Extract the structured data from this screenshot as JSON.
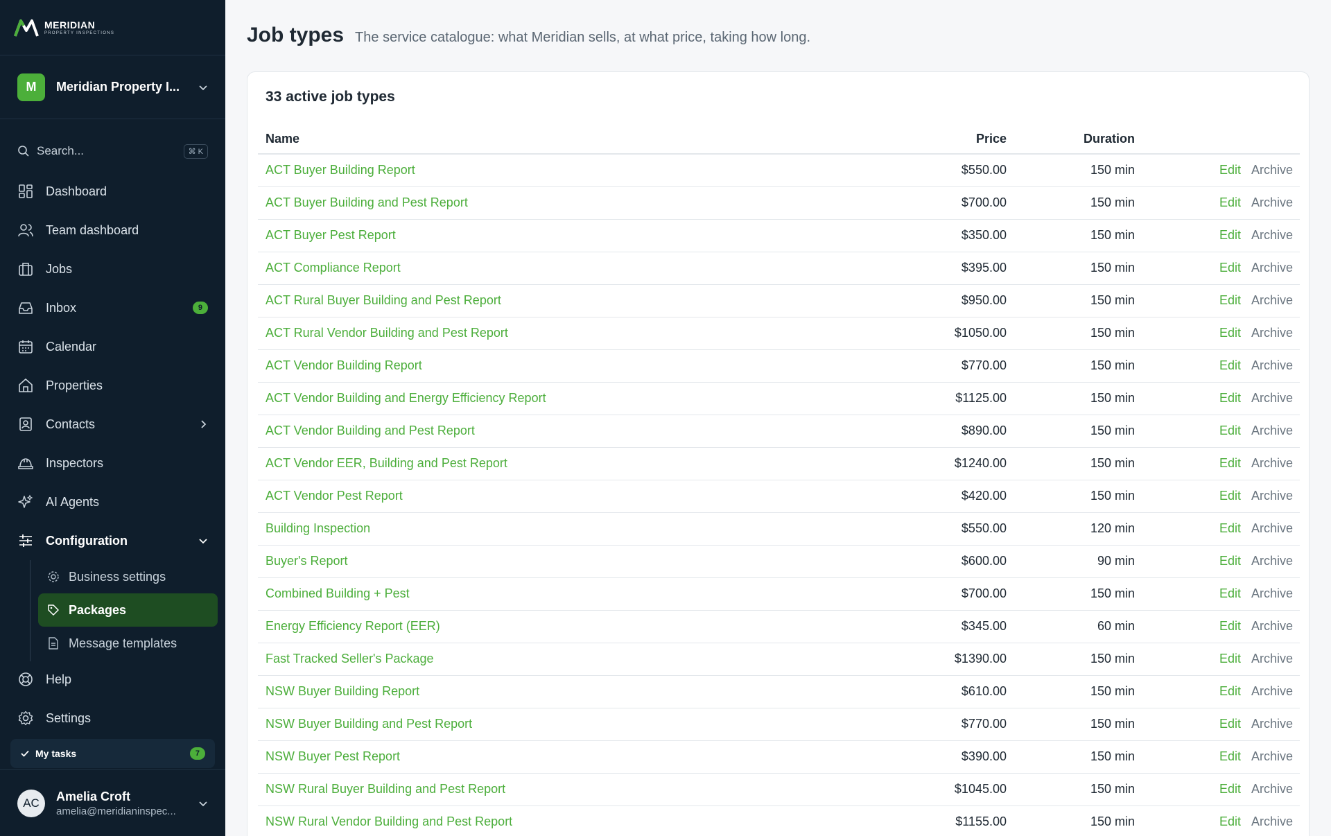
{
  "brand": {
    "name": "MERIDIAN",
    "tagline": "PROPERTY INSPECTIONS"
  },
  "org": {
    "initial": "M",
    "name": "Meridian Property I..."
  },
  "search": {
    "placeholder": "Search...",
    "shortcut": "⌘ K"
  },
  "nav": {
    "dashboard": "Dashboard",
    "team_dashboard": "Team dashboard",
    "jobs": "Jobs",
    "inbox": "Inbox",
    "inbox_count": "9",
    "calendar": "Calendar",
    "properties": "Properties",
    "contacts": "Contacts",
    "inspectors": "Inspectors",
    "ai_agents": "AI Agents",
    "configuration": "Configuration",
    "business_settings": "Business settings",
    "packages": "Packages",
    "message_templates": "Message templates",
    "help": "Help",
    "settings": "Settings"
  },
  "tasks": {
    "label": "My tasks",
    "count": "7"
  },
  "user": {
    "initials": "AC",
    "name": "Amelia Croft",
    "email": "amelia@meridianinspec..."
  },
  "page": {
    "title": "Job types",
    "subtitle": "The service catalogue: what Meridian sells, at what price, taking how long."
  },
  "card": {
    "title": "33 active job types"
  },
  "table": {
    "headers": {
      "name": "Name",
      "price": "Price",
      "duration": "Duration"
    },
    "edit_label": "Edit",
    "archive_label": "Archive",
    "rows": [
      {
        "name": "ACT Buyer Building Report",
        "price": "$550.00",
        "duration": "150 min"
      },
      {
        "name": "ACT Buyer Building and Pest Report",
        "price": "$700.00",
        "duration": "150 min"
      },
      {
        "name": "ACT Buyer Pest Report",
        "price": "$350.00",
        "duration": "150 min"
      },
      {
        "name": "ACT Compliance Report",
        "price": "$395.00",
        "duration": "150 min"
      },
      {
        "name": "ACT Rural Buyer Building and Pest Report",
        "price": "$950.00",
        "duration": "150 min"
      },
      {
        "name": "ACT Rural Vendor Building and Pest Report",
        "price": "$1050.00",
        "duration": "150 min"
      },
      {
        "name": "ACT Vendor Building Report",
        "price": "$770.00",
        "duration": "150 min"
      },
      {
        "name": "ACT Vendor Building and Energy Efficiency Report",
        "price": "$1125.00",
        "duration": "150 min"
      },
      {
        "name": "ACT Vendor Building and Pest Report",
        "price": "$890.00",
        "duration": "150 min"
      },
      {
        "name": "ACT Vendor EER, Building and Pest Report",
        "price": "$1240.00",
        "duration": "150 min"
      },
      {
        "name": "ACT Vendor Pest Report",
        "price": "$420.00",
        "duration": "150 min"
      },
      {
        "name": "Building Inspection",
        "price": "$550.00",
        "duration": "120 min"
      },
      {
        "name": "Buyer's Report",
        "price": "$600.00",
        "duration": "90 min"
      },
      {
        "name": "Combined Building + Pest",
        "price": "$700.00",
        "duration": "150 min"
      },
      {
        "name": "Energy Efficiency Report (EER)",
        "price": "$345.00",
        "duration": "60 min"
      },
      {
        "name": "Fast Tracked Seller's Package",
        "price": "$1390.00",
        "duration": "150 min"
      },
      {
        "name": "NSW Buyer Building Report",
        "price": "$610.00",
        "duration": "150 min"
      },
      {
        "name": "NSW Buyer Building and Pest Report",
        "price": "$770.00",
        "duration": "150 min"
      },
      {
        "name": "NSW Buyer Pest Report",
        "price": "$390.00",
        "duration": "150 min"
      },
      {
        "name": "NSW Rural Buyer Building and Pest Report",
        "price": "$1045.00",
        "duration": "150 min"
      },
      {
        "name": "NSW Rural Vendor Building and Pest Report",
        "price": "$1155.00",
        "duration": "150 min"
      }
    ]
  },
  "colors": {
    "accent": "#4cae3b",
    "sidebar_bg": "#0f1e2c",
    "selected_bg": "#1e4d22"
  }
}
